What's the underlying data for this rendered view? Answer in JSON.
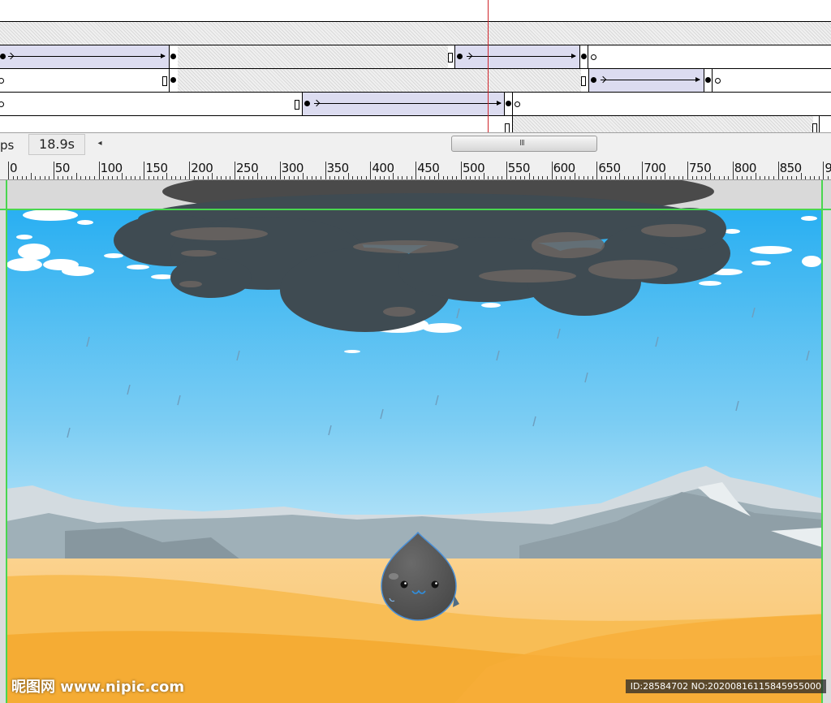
{
  "timeline": {
    "playhead_color": "#d0242a",
    "tween_color": "#dcdcf0"
  },
  "status": {
    "fps_label": "ps",
    "elapsed_time": "18.9s",
    "scroll_left_glyph": "◂",
    "scroll_thumb_grip": "III"
  },
  "ruler": {
    "labels": [
      "0",
      "50",
      "100",
      "150",
      "200",
      "250",
      "300",
      "350",
      "400",
      "450",
      "500",
      "550",
      "600",
      "650",
      "700",
      "750",
      "800",
      "850",
      "9"
    ]
  },
  "watermarks": {
    "site": "昵图网 www.nipic.com",
    "image_id": "ID:28584702 NO:20200816115845955000"
  },
  "colors": {
    "sky_top": "#29aff2",
    "sky_bottom": "#d6f0fb",
    "cloud_dark": "#3f4b52",
    "sand": "#f7b84d",
    "mountain": "#9fb0b8",
    "guide": "#49d64f"
  },
  "icons": {
    "scroll_left": "arrow-left-icon",
    "grip": "grip-icon"
  }
}
